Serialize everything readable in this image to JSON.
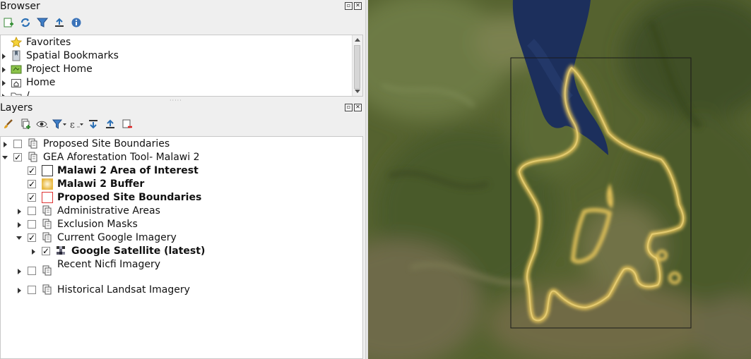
{
  "browser": {
    "title": "Browser",
    "items": [
      {
        "label": "Favorites",
        "icon": "star-icon"
      },
      {
        "label": "Spatial Bookmarks",
        "icon": "bookmarks-icon"
      },
      {
        "label": "Project Home",
        "icon": "project-home-icon"
      },
      {
        "label": "Home",
        "icon": "home-folder-icon"
      },
      {
        "label": "/",
        "icon": "folder-icon"
      }
    ]
  },
  "layers": {
    "title": "Layers",
    "items": [
      {
        "label": "Proposed Site Boundaries",
        "checked": false,
        "expand": "collapsed",
        "bold": false
      },
      {
        "label": "GEA Aforestation Tool- Malawi 2",
        "checked": true,
        "expand": "expanded",
        "bold": false
      },
      {
        "label": "Malawi 2 Area of Interest",
        "checked": true,
        "expand": "none",
        "bold": true
      },
      {
        "label": "Malawi 2 Buffer",
        "checked": true,
        "expand": "none",
        "bold": true
      },
      {
        "label": "Proposed Site Boundaries",
        "checked": true,
        "expand": "none",
        "bold": true
      },
      {
        "label": "Administrative Areas",
        "checked": false,
        "expand": "collapsed",
        "bold": false
      },
      {
        "label": "Exclusion Masks",
        "checked": false,
        "expand": "collapsed",
        "bold": false
      },
      {
        "label": "Current Google Imagery",
        "checked": true,
        "expand": "expanded",
        "bold": false
      },
      {
        "label": "Google Satellite (latest)",
        "checked": true,
        "expand": "collapsed",
        "bold": true
      },
      {
        "label": "Recent Nicfi Imagery",
        "checked": false,
        "expand": "collapsed",
        "bold": false
      },
      {
        "label": "Historical Landsat Imagery",
        "checked": false,
        "expand": "collapsed",
        "bold": false
      }
    ]
  },
  "colors": {
    "buffer_outline": "#e6c45a",
    "lake": "#1c2f5c",
    "terrain": "#55622f",
    "extent_frame": "#1a1a1a"
  }
}
